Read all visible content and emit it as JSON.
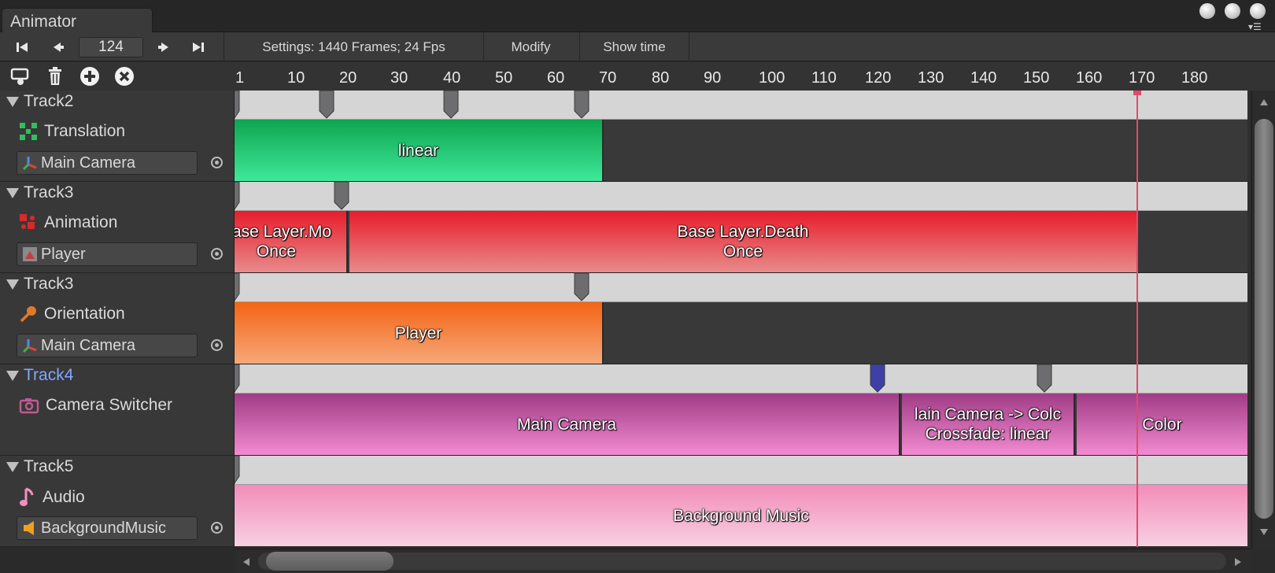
{
  "window": {
    "tab_title": "Animator"
  },
  "toolbar": {
    "current_frame": "124",
    "settings_label": "Settings: 1440 Frames; 24 Fps",
    "modify_label": "Modify",
    "show_time_label": "Show time"
  },
  "ruler": {
    "ticks": [
      "1",
      "10",
      "20",
      "30",
      "40",
      "50",
      "60",
      "70",
      "80",
      "90",
      "100",
      "110",
      "120",
      "130",
      "140",
      "150",
      "160",
      "170",
      "180"
    ]
  },
  "tracks": [
    {
      "name": "Track2",
      "type": "Translation",
      "type_icon": "translation-icon",
      "object": "Main Camera",
      "object_icon": "transform-icon",
      "selected": false
    },
    {
      "name": "Track3",
      "type": "Animation",
      "type_icon": "animation-icon",
      "object": "Player",
      "object_icon": "animator-object-icon",
      "selected": false
    },
    {
      "name": "Track3",
      "type": "Orientation",
      "type_icon": "orientation-icon",
      "object": "Main Camera",
      "object_icon": "transform-icon",
      "selected": false
    },
    {
      "name": "Track4",
      "type": "Camera Switcher",
      "type_icon": "camera-icon",
      "object": "",
      "object_icon": "",
      "selected": true
    },
    {
      "name": "Track5",
      "type": "Audio",
      "type_icon": "music-note-icon",
      "object": "BackgroundMusic",
      "object_icon": "audio-source-icon",
      "selected": false
    }
  ],
  "clips": {
    "t0": [
      "linear"
    ],
    "t1": [
      "Base Layer.Mo\nOnce",
      "Base Layer.Death\nOnce"
    ],
    "t2": [
      "Player"
    ],
    "t3": [
      "Main Camera",
      "lain Camera -> Colc\nCrossfade: linear",
      "Color"
    ],
    "t4": [
      "Background Music"
    ]
  },
  "colors": {
    "translation": "#29d17c",
    "animation": "#e52633",
    "orientation": "#f6761f",
    "camera": "#c7569b",
    "audio": "#f4a3c4",
    "playhead": "#e24a6d",
    "selected_track": "#7fa7ff"
  }
}
